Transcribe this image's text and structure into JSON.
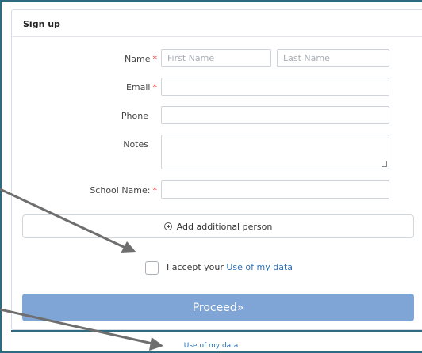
{
  "card": {
    "title": "Sign up"
  },
  "form": {
    "name_label": "Name",
    "first_name_placeholder": "First Name",
    "last_name_placeholder": "Last Name",
    "email_label": "Email",
    "phone_label": "Phone",
    "notes_label": "Notes",
    "school_label": "School Name:",
    "required_mark": "*"
  },
  "actions": {
    "add_person_label": "Add additional person",
    "accept_prefix": "I accept your",
    "accept_link": "Use of my data",
    "proceed_label": "Proceed",
    "proceed_suffix": "»"
  },
  "footer": {
    "link": "Use of my data"
  },
  "colors": {
    "proceed_bg": "#7fa4d6",
    "link": "#2e70b6",
    "required": "#d9302c",
    "frame": "#2e6a80",
    "arrow": "#707070"
  }
}
